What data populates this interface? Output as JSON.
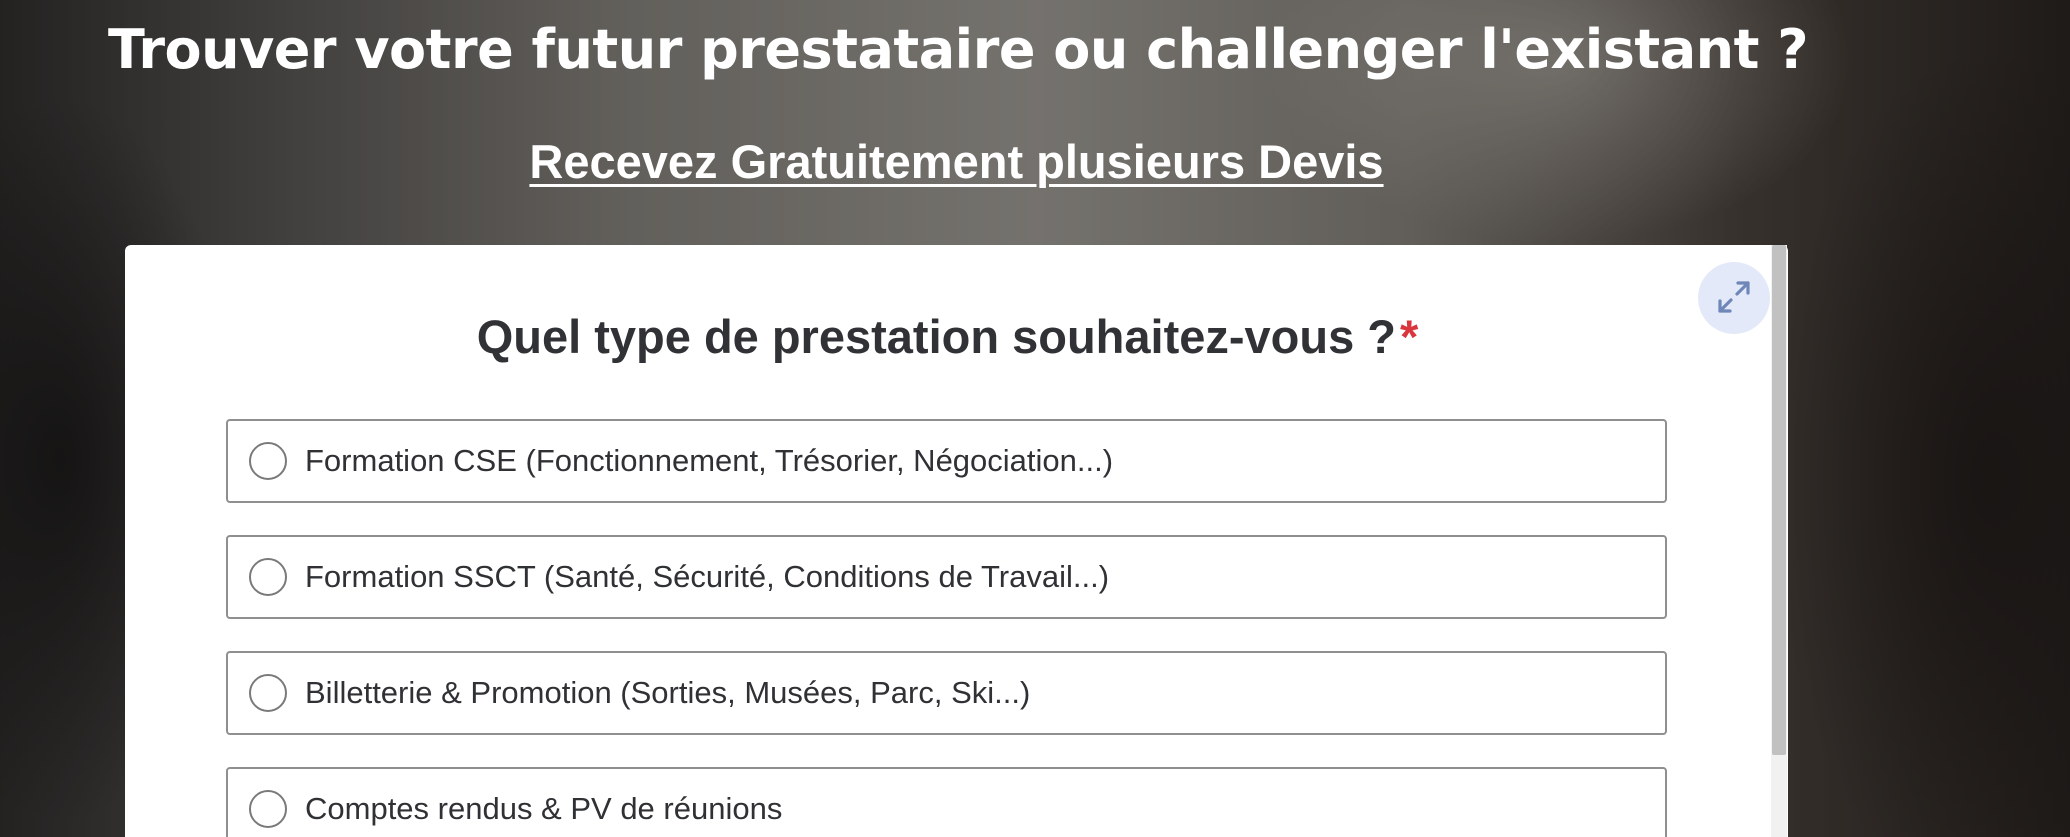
{
  "hero": {
    "title": "Trouver votre futur prestataire ou challenger l'existant ?",
    "subtitle": "Recevez Gratuitement plusieurs Devis"
  },
  "form": {
    "question": "Quel type de prestation souhaitez-vous ?",
    "required_mark": "*",
    "expand_icon": "expand-arrows-icon",
    "options": [
      {
        "label": "Formation CSE (Fonctionnement, Trésorier, Négociation...)",
        "selected": false
      },
      {
        "label": "Formation SSCT (Santé, Sécurité, Conditions de Travail...)",
        "selected": false
      },
      {
        "label": "Billetterie & Promotion (Sorties, Musées, Parc, Ski...)",
        "selected": false
      },
      {
        "label": "Comptes rendus & PV de réunions",
        "selected": false
      }
    ]
  },
  "colors": {
    "required": "#d9363e",
    "expand_button_bg": "#e3e9f8",
    "expand_icon": "#6f86b8",
    "option_border": "#8f8f8f",
    "question_text": "#303236"
  }
}
